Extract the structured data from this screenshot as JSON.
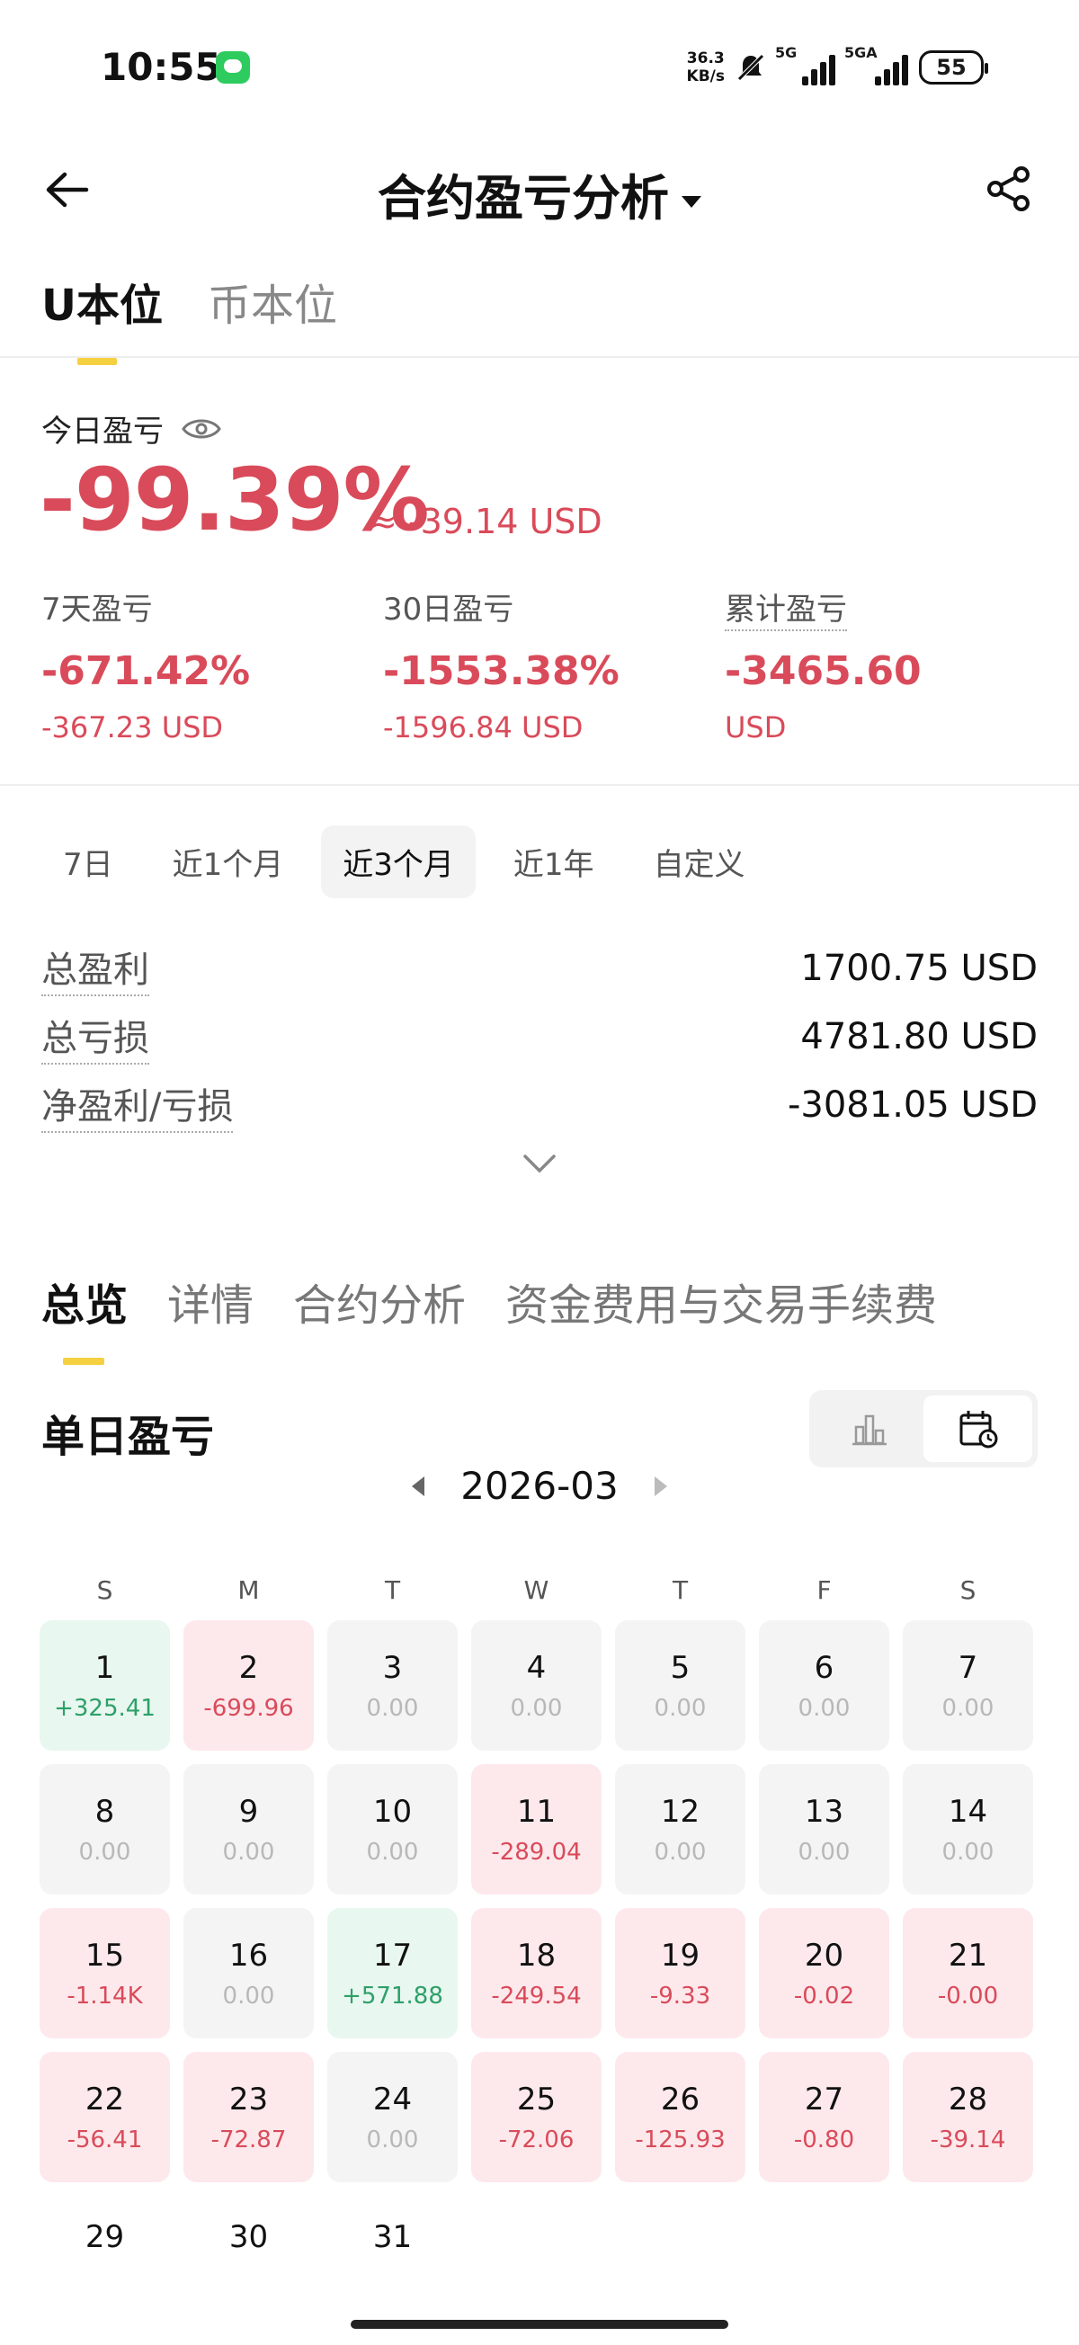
{
  "status_bar": {
    "time": "10:55",
    "net_speed_top": "36.3",
    "net_speed_bottom": "KB/s",
    "sig1": "5G",
    "sig2": "5GA",
    "battery": "55"
  },
  "header": {
    "title": "合约盈亏分析"
  },
  "unit_tabs": [
    "U本位",
    "币本位"
  ],
  "today": {
    "label": "今日盈亏",
    "pct": "-99.39%",
    "usd": "≈ -39.14 USD"
  },
  "stats": [
    {
      "label": "7天盈亏",
      "pct": "-671.42%",
      "usd": "-367.23 USD"
    },
    {
      "label": "30日盈亏",
      "pct": "-1553.38%",
      "usd": "-1596.84 USD"
    },
    {
      "label": "累计盈亏",
      "pct": "-3465.60",
      "usd": "USD"
    }
  ],
  "periods": [
    "7日",
    "近1个月",
    "近3个月",
    "近1年",
    "自定义"
  ],
  "summary": [
    {
      "label": "总盈利",
      "value": "1700.75 USD"
    },
    {
      "label": "总亏损",
      "value": "4781.80 USD"
    },
    {
      "label": "净盈利/亏损",
      "value": "-3081.05 USD"
    }
  ],
  "section_tabs": [
    "总览",
    "详情",
    "合约分析",
    "资金费用与交易手续费"
  ],
  "daily": {
    "title": "单日盈亏",
    "month": "2026-03"
  },
  "weekdays": [
    "S",
    "M",
    "T",
    "W",
    "T",
    "F",
    "S"
  ],
  "days": [
    {
      "num": "1",
      "val": "+325.41",
      "type": "gain"
    },
    {
      "num": "2",
      "val": "-699.96",
      "type": "loss"
    },
    {
      "num": "3",
      "val": "0.00",
      "type": "zero"
    },
    {
      "num": "4",
      "val": "0.00",
      "type": "zero"
    },
    {
      "num": "5",
      "val": "0.00",
      "type": "zero"
    },
    {
      "num": "6",
      "val": "0.00",
      "type": "zero"
    },
    {
      "num": "7",
      "val": "0.00",
      "type": "zero"
    },
    {
      "num": "8",
      "val": "0.00",
      "type": "zero"
    },
    {
      "num": "9",
      "val": "0.00",
      "type": "zero"
    },
    {
      "num": "10",
      "val": "0.00",
      "type": "zero"
    },
    {
      "num": "11",
      "val": "-289.04",
      "type": "loss"
    },
    {
      "num": "12",
      "val": "0.00",
      "type": "zero"
    },
    {
      "num": "13",
      "val": "0.00",
      "type": "zero"
    },
    {
      "num": "14",
      "val": "0.00",
      "type": "zero"
    },
    {
      "num": "15",
      "val": "-1.14K",
      "type": "loss"
    },
    {
      "num": "16",
      "val": "0.00",
      "type": "zero"
    },
    {
      "num": "17",
      "val": "+571.88",
      "type": "gain"
    },
    {
      "num": "18",
      "val": "-249.54",
      "type": "loss"
    },
    {
      "num": "19",
      "val": "-9.33",
      "type": "loss"
    },
    {
      "num": "20",
      "val": "-0.02",
      "type": "loss"
    },
    {
      "num": "21",
      "val": "-0.00",
      "type": "loss"
    },
    {
      "num": "22",
      "val": "-56.41",
      "type": "loss"
    },
    {
      "num": "23",
      "val": "-72.87",
      "type": "loss"
    },
    {
      "num": "24",
      "val": "0.00",
      "type": "zero"
    },
    {
      "num": "25",
      "val": "-72.06",
      "type": "loss"
    },
    {
      "num": "26",
      "val": "-125.93",
      "type": "loss"
    },
    {
      "num": "27",
      "val": "-0.80",
      "type": "loss"
    },
    {
      "num": "28",
      "val": "-39.14",
      "type": "loss"
    },
    {
      "num": "29",
      "val": "",
      "type": "empty"
    },
    {
      "num": "30",
      "val": "",
      "type": "empty"
    },
    {
      "num": "31",
      "val": "",
      "type": "empty"
    }
  ],
  "colors": {
    "loss": "#d94b5a",
    "gain": "#2ea06a",
    "accent": "#f5d040"
  }
}
